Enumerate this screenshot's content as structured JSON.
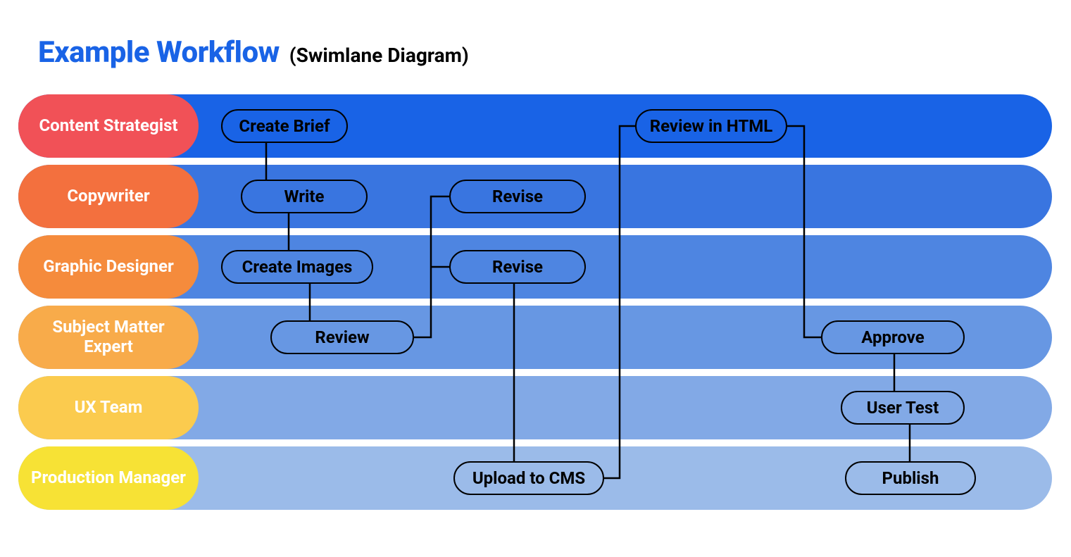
{
  "title": {
    "main": "Example Workflow",
    "sub": "(Swimlane Diagram)"
  },
  "lanes": [
    {
      "id": "content-strategist",
      "label": "Content Strategist",
      "label_color": "#f15157",
      "lane_color": "#1963e6"
    },
    {
      "id": "copywriter",
      "label": "Copywriter",
      "label_color": "#f3703e",
      "lane_color": "#3975e0"
    },
    {
      "id": "graphic-designer",
      "label": "Graphic Designer",
      "label_color": "#f58b3c",
      "lane_color": "#4e85e1"
    },
    {
      "id": "subject-matter-expert",
      "label": "Subject Matter Expert",
      "label_color": "#f8ab4a",
      "lane_color": "#6797e3"
    },
    {
      "id": "ux-team",
      "label": "UX Team",
      "label_color": "#fbcb4e",
      "lane_color": "#82a9e6"
    },
    {
      "id": "production-manager",
      "label": "Production Manager",
      "label_color": "#f7e235",
      "lane_color": "#9bbbe9"
    }
  ],
  "tasks": {
    "create_brief": {
      "label": "Create Brief",
      "lane": 0
    },
    "write": {
      "label": "Write",
      "lane": 1
    },
    "create_images": {
      "label": "Create Images",
      "lane": 2
    },
    "review": {
      "label": "Review",
      "lane": 3
    },
    "revise_copy": {
      "label": "Revise",
      "lane": 1
    },
    "revise_design": {
      "label": "Revise",
      "lane": 2
    },
    "upload_to_cms": {
      "label": "Upload to CMS",
      "lane": 5
    },
    "review_in_html": {
      "label": "Review in HTML",
      "lane": 0
    },
    "approve": {
      "label": "Approve",
      "lane": 3
    },
    "user_test": {
      "label": "User Test",
      "lane": 4
    },
    "publish": {
      "label": "Publish",
      "lane": 5
    }
  },
  "flow": [
    [
      "create_brief",
      "write"
    ],
    [
      "write",
      "create_images"
    ],
    [
      "create_images",
      "review"
    ],
    [
      "review",
      "revise_copy"
    ],
    [
      "review",
      "revise_design"
    ],
    [
      "revise_design",
      "upload_to_cms"
    ],
    [
      "upload_to_cms",
      "review_in_html"
    ],
    [
      "review_in_html",
      "approve"
    ],
    [
      "approve",
      "user_test"
    ],
    [
      "user_test",
      "publish"
    ]
  ]
}
